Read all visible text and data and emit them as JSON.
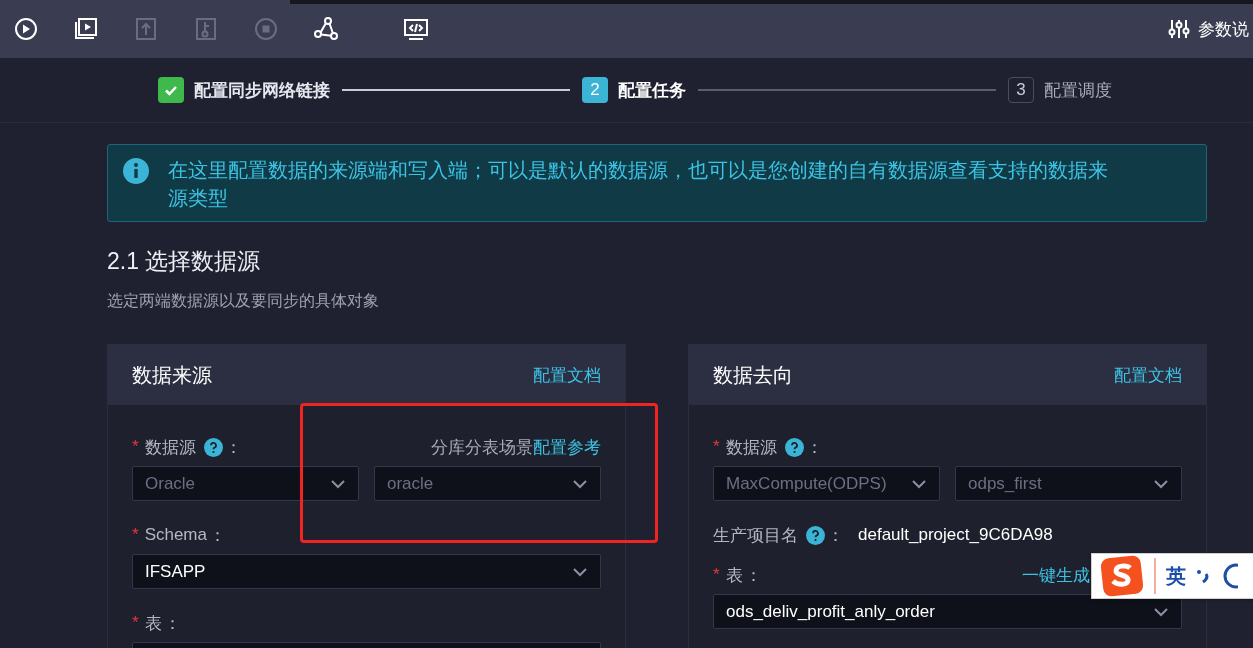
{
  "toolbar": {
    "buttons": [
      {
        "kind": "play",
        "disabled": false
      },
      {
        "kind": "media",
        "disabled": false
      },
      {
        "kind": "upload",
        "disabled": true
      },
      {
        "kind": "branch",
        "disabled": true
      },
      {
        "kind": "stop",
        "disabled": true
      },
      {
        "kind": "graph",
        "disabled": false
      },
      {
        "kind": "code",
        "disabled": false
      }
    ],
    "help": {
      "label": "参数说"
    }
  },
  "steps": [
    {
      "label": "配置同步网络链接",
      "done": true,
      "selected": false
    },
    {
      "number": "2",
      "label": "配置任务",
      "done": false,
      "selected": true
    },
    {
      "number": "3",
      "label": "配置调度",
      "done": false,
      "selected": false
    }
  ],
  "notice": {
    "text": "在这里配置数据的来源端和写入端；可以是默认的数据源，也可以是您创建的自有数据源查看支持的数据来源类型"
  },
  "section": {
    "title": "2.1 选择数据源",
    "subtitle": "选定两端数据源以及要同步的具体对象"
  },
  "panels": [
    {
      "title": "数据来源",
      "doc_link": "配置文档",
      "fields": [
        {
          "kind": "select-pair",
          "label": "数据源",
          "colon": "：",
          "required": "*",
          "help": true,
          "note": "分库分表场景",
          "note_link": "配置参考",
          "selects": [
            {
              "value": "Oracle",
              "disabled": true
            },
            {
              "value": "oracle",
              "disabled": true
            }
          ]
        },
        {
          "kind": "select",
          "label": "Schema",
          "colon": "：",
          "required": "*",
          "value": "IFSAPP"
        },
        {
          "kind": "select",
          "label": "表",
          "colon": "：",
          "required": "*"
        }
      ]
    },
    {
      "title": "数据去向",
      "doc_link": "配置文档",
      "fields": [
        {
          "kind": "select-pair",
          "label": "数据源",
          "colon": "：",
          "required": "*",
          "help": true,
          "selects": [
            {
              "value": "MaxCompute(ODPS)",
              "disabled": true
            },
            {
              "value": "odps_first",
              "disabled": true
            }
          ]
        },
        {
          "kind": "info",
          "label": "生产项目名",
          "colon": "：",
          "help": true,
          "value": "default_project_9C6DA98"
        },
        {
          "kind": "select",
          "label": "表",
          "colon": "：",
          "required": "*",
          "action": "一键生成",
          "value": "ods_deliv_profit_anly_order"
        }
      ]
    }
  ],
  "ime": {
    "label": "英"
  }
}
